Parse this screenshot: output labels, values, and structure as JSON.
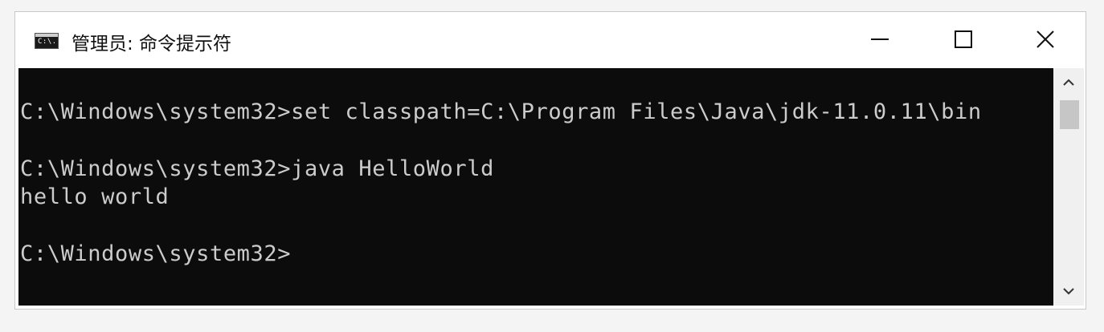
{
  "window": {
    "title": "管理员: 命令提示符",
    "icon": "cmd-icon",
    "icon_glyph": "C:\\."
  },
  "controls": {
    "minimize": "minimize-icon",
    "maximize": "maximize-icon",
    "close": "close-icon"
  },
  "terminal": {
    "lines": [
      "C:\\Windows\\system32>set classpath=C:\\Program Files\\Java\\jdk-11.0.11\\bin",
      "C:\\Windows\\system32>java HelloWorld",
      "hello world",
      "C:\\Windows\\system32>"
    ],
    "background": "#0c0c0c",
    "foreground": "#cccccc"
  },
  "scrollbar": {
    "up": "chevron-up-icon",
    "down": "chevron-down-icon"
  }
}
